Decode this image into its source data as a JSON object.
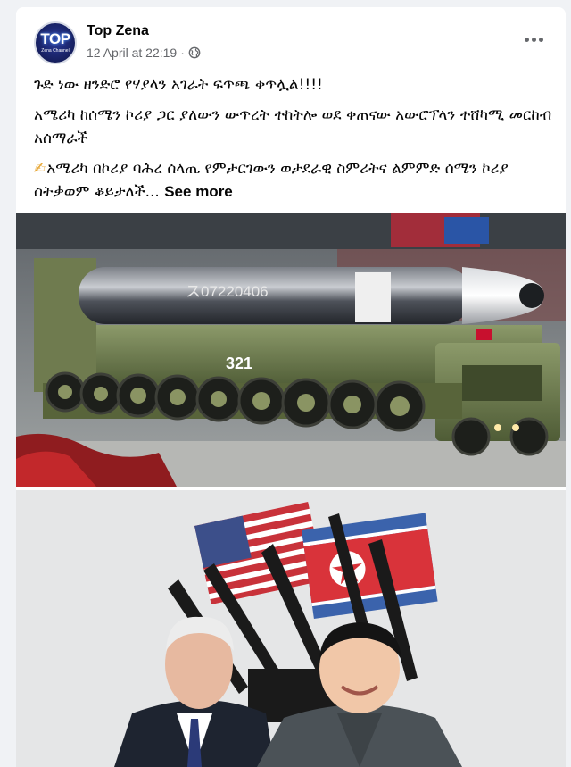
{
  "post": {
    "page_name": "Top Zena",
    "avatar": {
      "big": "TOP",
      "small": "Zena Channel"
    },
    "timestamp": "12 April at 22:19",
    "separator": "·",
    "privacy_icon": "globe-icon",
    "more_icon": "more-horizontal-icon",
    "text": {
      "line1": "ጉድ ነው ዘንድሮ የሃያላን አገራት ፍጥጫ ቀጥሏል!!!!",
      "line2": "አሜሪካ ከሰሜን ኮሪያ ጋር ያለውን ውጥረት ተከትሎ ወደ ቀጠናው አውሮፕላን ተሸካሚ መርከብ አሰማራች",
      "line3_icon": "✍",
      "line3": "አሜሪካ በኮሪያ ባሕረ ሰላጤ የምታርገውን ወታደራዊ ስምሪትና ልምምድ ሰሜን ኮሪያ ስትቃወም ቆይታለች...",
      "see_more": "See more"
    },
    "photo1": {
      "missile_serial": "ス07220406",
      "vehicle_mark": "321"
    },
    "photo2": {}
  }
}
